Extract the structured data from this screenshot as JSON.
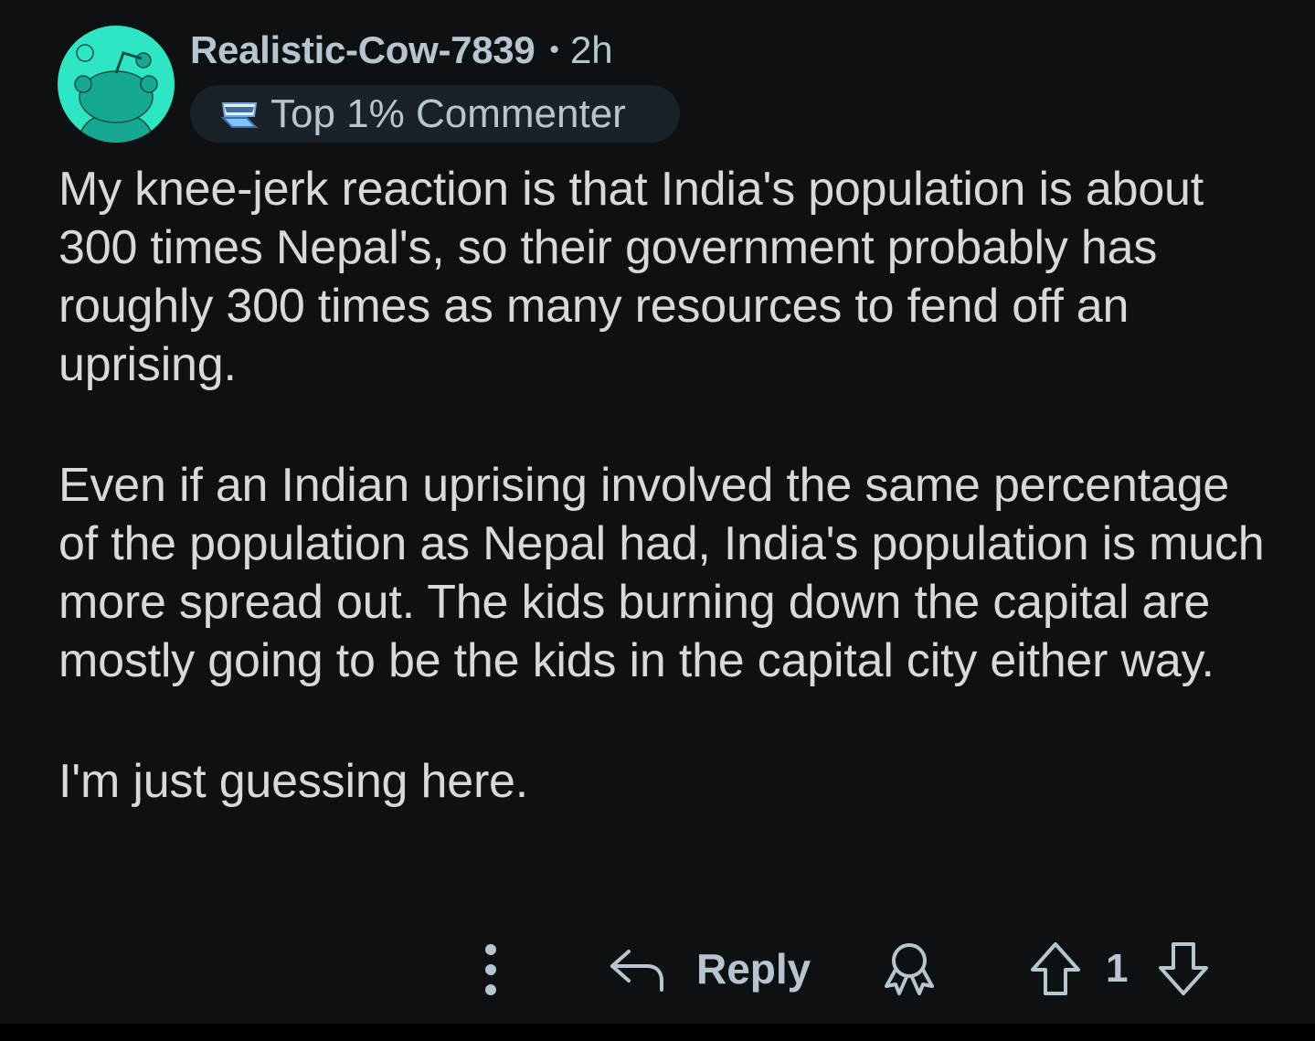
{
  "comment": {
    "author": "Realistic-Cow-7839",
    "separator": "•",
    "time_ago": "2h",
    "flair": {
      "icon": "top-commenter-icon",
      "label": "Top 1% Commenter"
    },
    "avatar": {
      "icon": "snoo-avatar",
      "background_color": "#2ee6c3"
    },
    "paragraphs": [
      "My knee-jerk reaction is that India's population is about 300 times Nepal's, so their government probably has roughly 300 times as many resources to fend off an uprising.",
      "Even if an Indian uprising involved the same percentage of the population as Nepal had, India's population is much more spread out. The kids burning down the capital are mostly going to be the kids in the capital city either way.",
      "I'm just guessing here."
    ],
    "actions": {
      "more_icon": "more-vertical-icon",
      "reply_label": "Reply",
      "reply_icon": "reply-arrow-icon",
      "award_icon": "award-icon",
      "upvote_icon": "upvote-arrow-icon",
      "vote_count": "1",
      "downvote_icon": "downvote-arrow-icon"
    }
  },
  "theme": {
    "background": "#0e1113",
    "text_primary": "#d7dadc",
    "text_secondary": "#b8c5cc",
    "flair_background": "#1b2227"
  }
}
